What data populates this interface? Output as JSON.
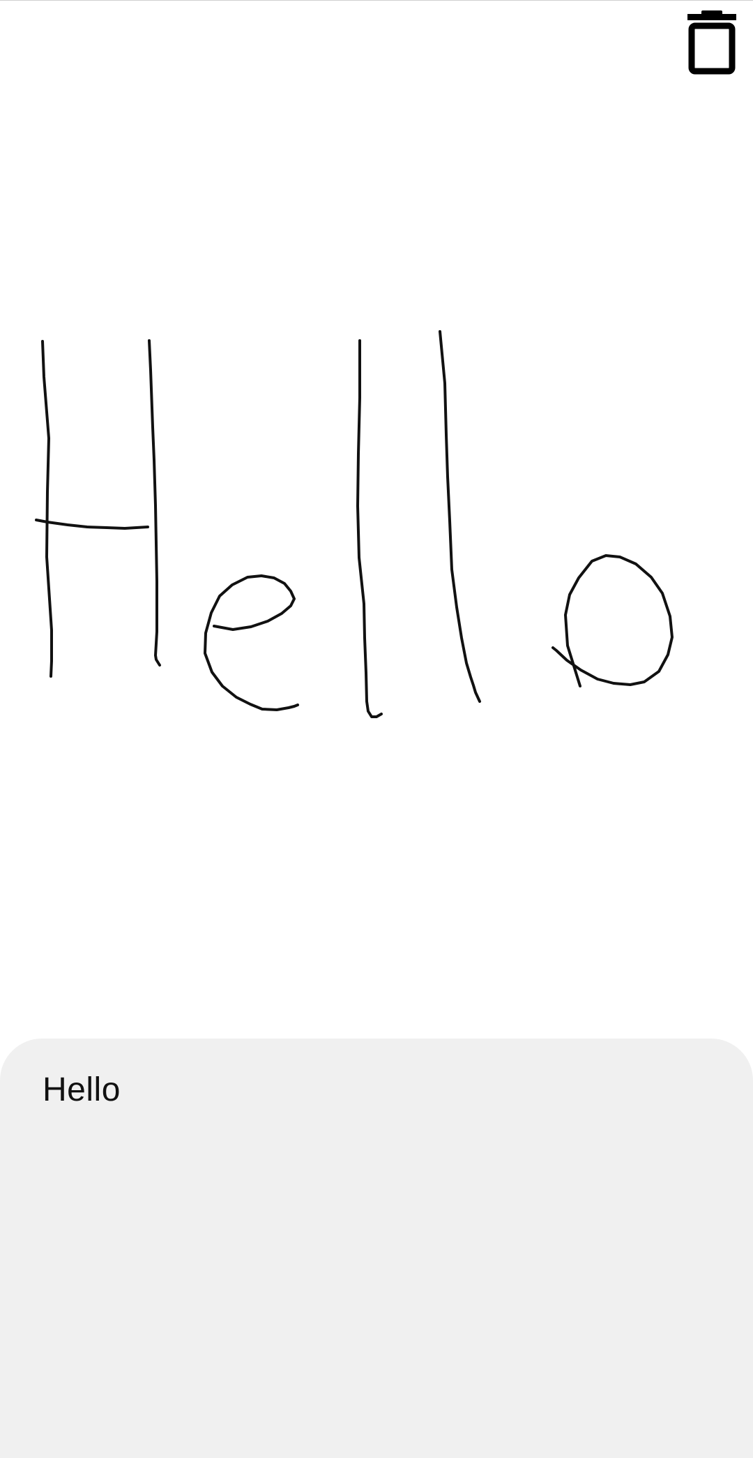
{
  "toolbar": {
    "delete_icon": "trash-icon",
    "icon_color": "#000000"
  },
  "canvas": {
    "stroke_color": "#111111",
    "background": "#ffffff"
  },
  "result": {
    "recognized_text": "Hello",
    "panel_color": "#f0f0f0"
  }
}
